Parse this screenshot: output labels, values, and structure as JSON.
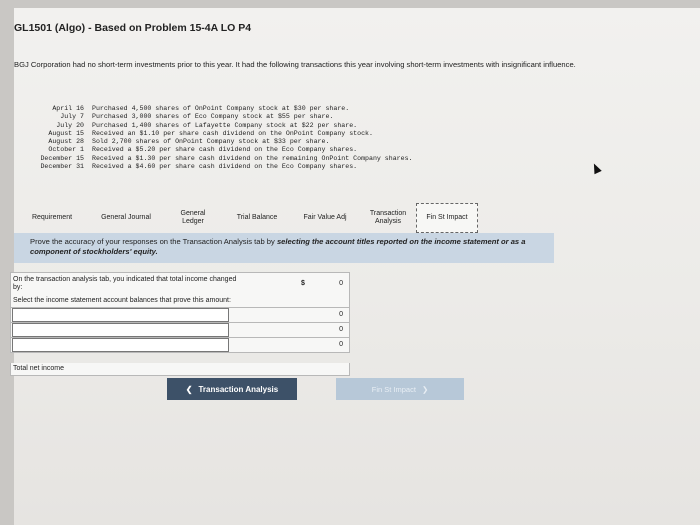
{
  "title": "GL1501 (Algo) - Based on Problem 15-4A LO P4",
  "intro": "BGJ Corporation had no short-term investments prior to this year. It had the following transactions this year involving short-term investments with insignificant influence.",
  "transactions": [
    {
      "date": "April 16",
      "text": "Purchased 4,500 shares of OnPoint Company stock at $30 per share."
    },
    {
      "date": "July 7",
      "text": "Purchased 3,000 shares of Eco Company stock at $55 per share."
    },
    {
      "date": "July 20",
      "text": "Purchased 1,400 shares of Lafayette Company stock at $22 per share."
    },
    {
      "date": "August 15",
      "text": "Received an $1.10 per share cash dividend on the OnPoint Company stock."
    },
    {
      "date": "August 28",
      "text": "Sold 2,700 shares of OnPoint Company stock at $33 per share."
    },
    {
      "date": "October 1",
      "text": "Received a $5.20 per share cash dividend on the Eco Company shares."
    },
    {
      "date": "December 15",
      "text": "Received a $1.30 per share cash dividend on the remaining OnPoint Company shares."
    },
    {
      "date": "December 31",
      "text": "Received a $4.60 per share cash dividend on the Eco Company shares."
    }
  ],
  "tabs": {
    "requirement": "Requirement",
    "general_journal": "General Journal",
    "general_ledger": "General Ledger",
    "trial_balance": "Trial Balance",
    "fair_value_adj": "Fair Value Adj",
    "transaction_analysis": "Transaction Analysis",
    "fin_st_impact": "Fin St Impact"
  },
  "instruction": {
    "prefix": "Prove the accuracy of your responses on the Transaction Analysis tab by ",
    "emphasis": "selecting the account titles reported on the income statement or as a component of stockholders' equity."
  },
  "table": {
    "indicated_label": "On the transaction analysis tab, you indicated that total income changed by:",
    "currency": "$",
    "indicated_value": "0",
    "select_label": "Select the income statement account balances that prove this amount:",
    "rows": [
      {
        "value": "0"
      },
      {
        "value": "0"
      },
      {
        "value": "0"
      }
    ],
    "total_label": "Total net income"
  },
  "buttons": {
    "prev_label": "Transaction Analysis",
    "next_label": "Fin St Impact"
  }
}
